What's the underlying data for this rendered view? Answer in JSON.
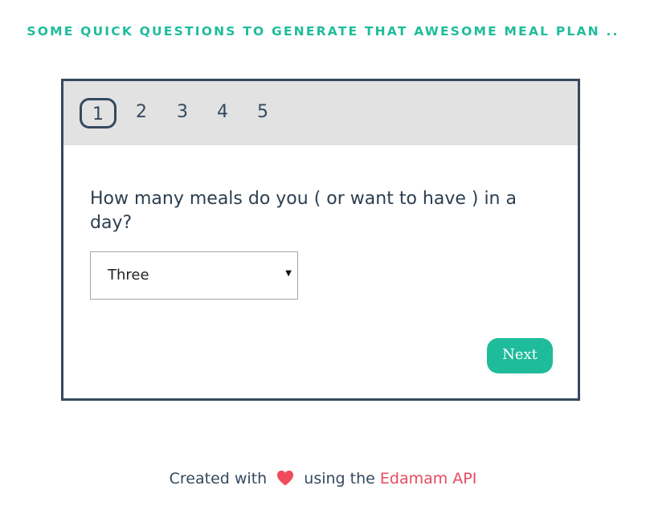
{
  "header": {
    "title": "SOME QUICK QUESTIONS TO GENERATE THAT AWESOME MEAL PLAN .."
  },
  "wizard": {
    "steps": [
      {
        "label": "1",
        "active": true
      },
      {
        "label": "2",
        "active": false
      },
      {
        "label": "3",
        "active": false
      },
      {
        "label": "4",
        "active": false
      },
      {
        "label": "5",
        "active": false
      }
    ],
    "question": "How many meals do you ( or want to have ) in a day?",
    "select": {
      "selected_value": "Three"
    },
    "next_label": "Next"
  },
  "footer": {
    "prefix": "Created with",
    "middle": "using the",
    "link_text": "Edamam API",
    "heart_icon": "heart-icon"
  },
  "colors": {
    "accent": "#1fbc9c",
    "text": "#34495e",
    "heart": "#ef4b5c",
    "link": "#e84a5f",
    "steps_bar": "#e2e2e2"
  }
}
